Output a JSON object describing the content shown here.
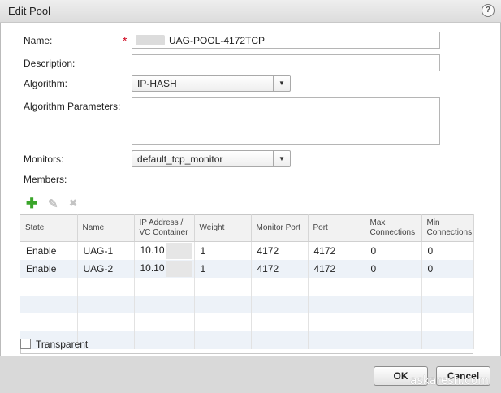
{
  "window": {
    "title": "Edit Pool",
    "help_glyph": "?"
  },
  "form": {
    "name_label": "Name:",
    "required_mark": "*",
    "name_value": "UAG-POOL-4172TCP",
    "description_label": "Description:",
    "description_value": "",
    "algorithm_label": "Algorithm:",
    "algorithm_value": "IP-HASH",
    "algorithm_params_label": "Algorithm Parameters:",
    "monitors_label": "Monitors:",
    "monitors_value": "default_tcp_monitor",
    "members_label": "Members:",
    "dropdown_glyph": "▼"
  },
  "toolbar": {
    "add_icon": "add-icon",
    "edit_icon": "pencil-icon",
    "delete_icon": "delete-icon",
    "add_glyph": "✚",
    "edit_glyph": "✎",
    "delete_glyph": "✖"
  },
  "members_table": {
    "columns": [
      "State",
      "Name",
      "IP Address / VC Container",
      "Weight",
      "Monitor Port",
      "Port",
      "Max Connections",
      "Min Connections"
    ],
    "rows": [
      {
        "state": "Enable",
        "name": "UAG-1",
        "ip": "10.10",
        "weight": "1",
        "monitor_port": "4172",
        "port": "4172",
        "max": "0",
        "min": "0"
      },
      {
        "state": "Enable",
        "name": "UAG-2",
        "ip": "10.10",
        "weight": "1",
        "monitor_port": "4172",
        "port": "4172",
        "max": "0",
        "min": "0"
      }
    ]
  },
  "transparent_label": "Transparent",
  "buttons": {
    "ok": "OK",
    "cancel": "Cancel"
  },
  "watermark": "askaresh.com",
  "colors": {
    "add_green": "#3aa52a",
    "required_red": "#d0021b",
    "row_alt": "#edf2f8",
    "footer_bg": "#d9d9d9"
  }
}
